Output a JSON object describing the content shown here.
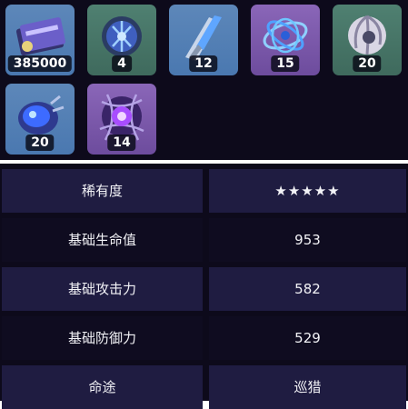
{
  "materials": [
    {
      "name": "credit-card-item",
      "count": "385000",
      "rarity": "blue"
    },
    {
      "name": "orb-item",
      "count": "4",
      "rarity": "green"
    },
    {
      "name": "crystal-shard-item",
      "count": "12",
      "rarity": "blue"
    },
    {
      "name": "tangled-wire-item",
      "count": "15",
      "rarity": "purple"
    },
    {
      "name": "shell-item",
      "count": "20",
      "rarity": "green"
    },
    {
      "name": "blue-beast-item",
      "count": "20",
      "rarity": "blue"
    },
    {
      "name": "purple-core-item",
      "count": "14",
      "rarity": "purple"
    }
  ],
  "stats": [
    {
      "label": "稀有度",
      "value": "★★★★★"
    },
    {
      "label": "基础生命值",
      "value": "953"
    },
    {
      "label": "基础攻击力",
      "value": "582"
    },
    {
      "label": "基础防御力",
      "value": "529"
    },
    {
      "label": "命途",
      "value": "巡猎"
    }
  ],
  "colors": {
    "background": "#0d0a1b",
    "row_odd": "#1f1c41",
    "row_even": "#0f0c20",
    "rarity_blue": "#5d87b9",
    "rarity_green": "#4f8071",
    "rarity_purple": "#8a66b8"
  }
}
